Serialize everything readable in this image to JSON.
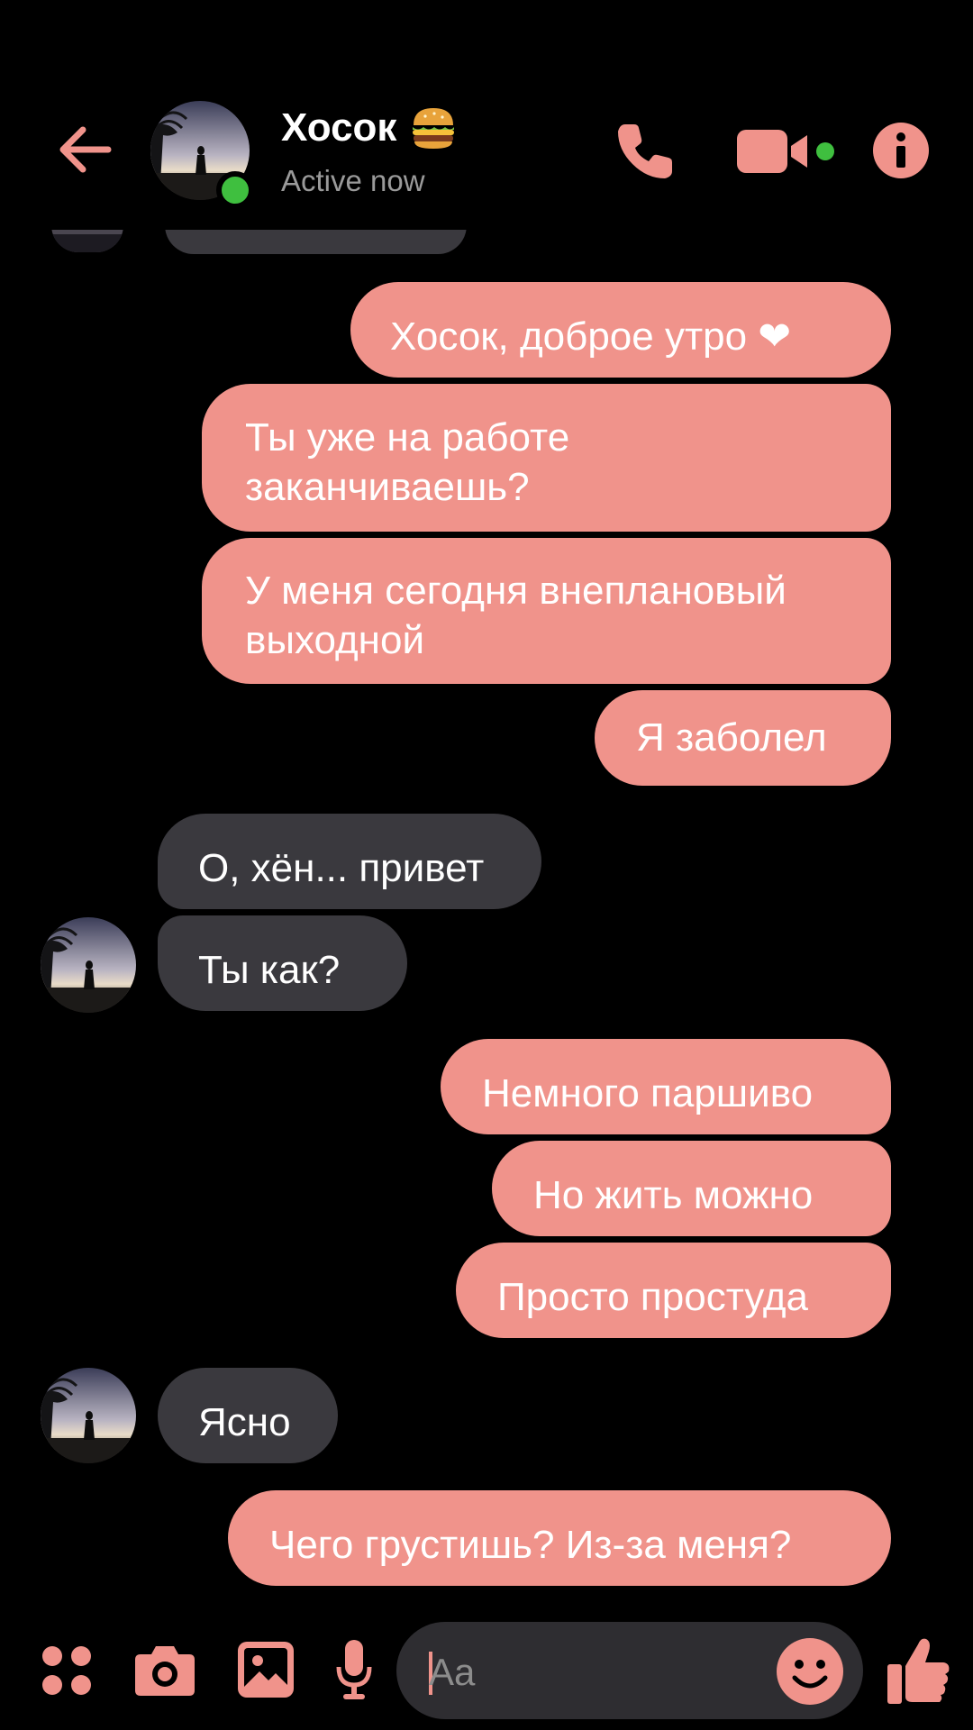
{
  "colors": {
    "accent": "#f0938b",
    "received_bubble": "#3a393e",
    "background": "#000000",
    "online": "#3fbf3f"
  },
  "header": {
    "back_icon": "arrow-left-icon",
    "contact_name": "Хосок",
    "contact_emoji": "🍔",
    "status": "Active now",
    "call_icon": "phone-icon",
    "video_icon": "video-camera-icon",
    "info_icon": "info-icon"
  },
  "messages": [
    {
      "side": "sent",
      "text": "Хосок, доброе утро ❤"
    },
    {
      "side": "sent",
      "lines": [
        "Ты уже на работе",
        "заканчиваешь?"
      ]
    },
    {
      "side": "sent",
      "lines": [
        "У меня сегодня внеплановый",
        "выходной"
      ]
    },
    {
      "side": "sent",
      "text": "Я заболел"
    },
    {
      "side": "received",
      "text": "О, хён... привет"
    },
    {
      "side": "received",
      "text": "Ты как?"
    },
    {
      "side": "sent",
      "text": "Немного паршиво"
    },
    {
      "side": "sent",
      "text": "Но жить можно"
    },
    {
      "side": "sent",
      "text": "Просто простуда"
    },
    {
      "side": "received",
      "text": "Ясно"
    },
    {
      "side": "sent",
      "text": "Чего грустишь? Из-за меня?"
    }
  ],
  "composer": {
    "placeholder": "Aa",
    "menu_icon": "four-dots-icon",
    "camera_icon": "camera-icon",
    "gallery_icon": "image-icon",
    "mic_icon": "microphone-icon",
    "emoji_icon": "smiley-icon",
    "like_icon": "thumbs-up-icon"
  }
}
